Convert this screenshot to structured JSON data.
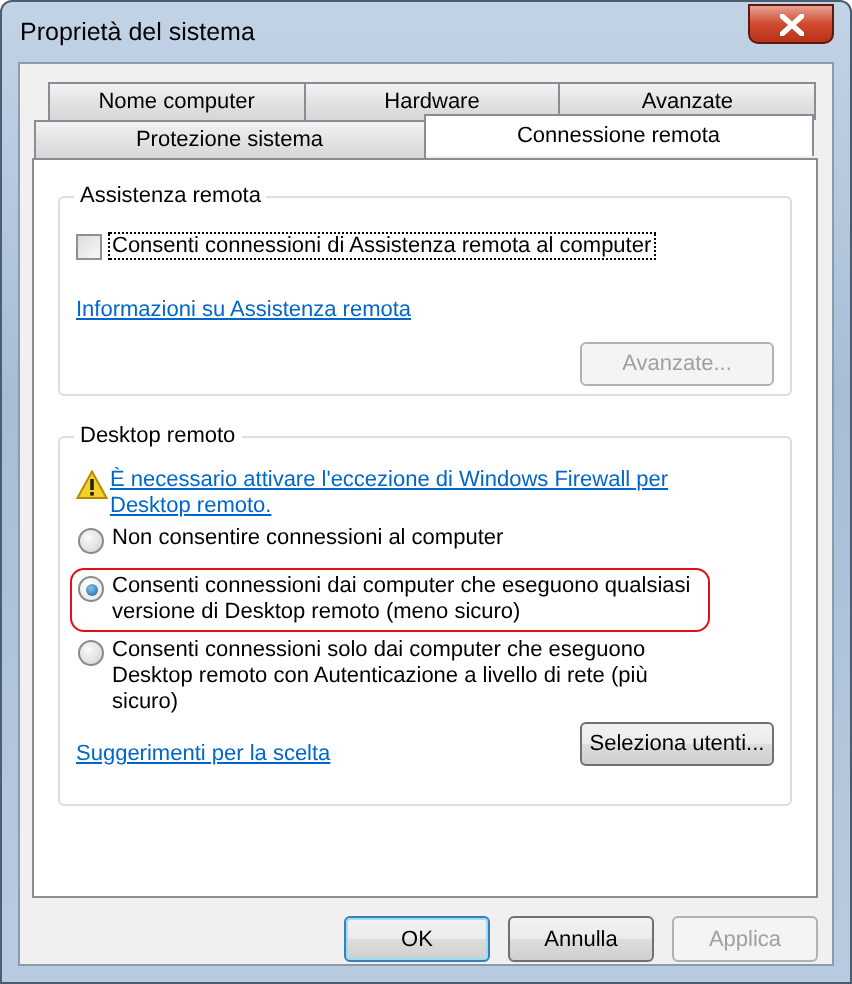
{
  "window": {
    "title": "Proprietà del sistema"
  },
  "tab_rows": [
    {
      "tabs": [
        {
          "label": "Nome computer",
          "selected": false
        },
        {
          "label": "Hardware",
          "selected": false
        },
        {
          "label": "Avanzate",
          "selected": false
        }
      ]
    },
    {
      "tabs": [
        {
          "label": "Protezione sistema",
          "selected": false
        },
        {
          "label": "Connessione remota",
          "selected": true
        }
      ]
    }
  ],
  "remote_assistance": {
    "title": "Assistenza remota",
    "checkbox": {
      "label": "Consenti connessioni di Assistenza remota al computer",
      "checked": false,
      "focused": true
    },
    "link": "Informazioni su Assistenza remota",
    "button": {
      "label": "Avanzate...",
      "disabled": true
    }
  },
  "remote_desktop": {
    "title": "Desktop remoto",
    "warning": "È necessario attivare l'eccezione di Windows Firewall per Desktop remoto.",
    "options": [
      {
        "label": "Non consentire connessioni al computer",
        "selected": false,
        "highlighted": false
      },
      {
        "label": "Consenti connessioni dai computer che eseguono qualsiasi versione di Desktop remoto (meno sicuro)",
        "selected": true,
        "highlighted": true
      },
      {
        "label": "Consenti connessioni solo dai computer che eseguono Desktop remoto con Autenticazione a livello di rete (più sicuro)",
        "selected": false,
        "highlighted": false
      }
    ],
    "link": "Suggerimenti per la scelta",
    "button": {
      "label": "Seleziona utenti...",
      "disabled": false
    }
  },
  "buttons": [
    {
      "label": "OK",
      "default": true,
      "disabled": false
    },
    {
      "label": "Annulla",
      "default": false,
      "disabled": false
    },
    {
      "label": "Applica",
      "default": false,
      "disabled": true
    }
  ]
}
